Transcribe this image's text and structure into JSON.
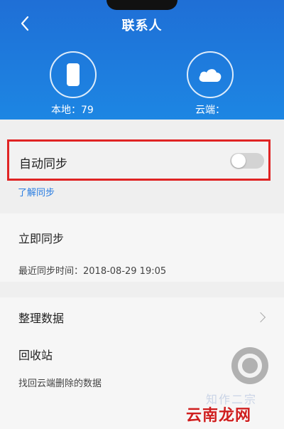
{
  "header": {
    "title": "联系人",
    "local_label": "本地：79",
    "cloud_label": "云端："
  },
  "auto_sync": {
    "label": "自动同步",
    "enabled": false,
    "learn_more": "了解同步"
  },
  "sync_now": {
    "title": "立即同步",
    "last_sync": "最近同步时间：2018-08-29 19:05"
  },
  "organize": {
    "title": "整理数据"
  },
  "recycle": {
    "title": "回收站",
    "subtitle": "找回云端删除的数据"
  },
  "watermark": {
    "text": "云南龙网",
    "faint": "知作二宗"
  },
  "colors": {
    "header_blue": "#1d7ee0",
    "highlight_red": "#e02424",
    "link_blue": "#2a7de1"
  },
  "icons": [
    "back-arrow-icon",
    "phone-icon",
    "cloud-icon",
    "chevron-right-icon",
    "floating-assist-icon"
  ]
}
